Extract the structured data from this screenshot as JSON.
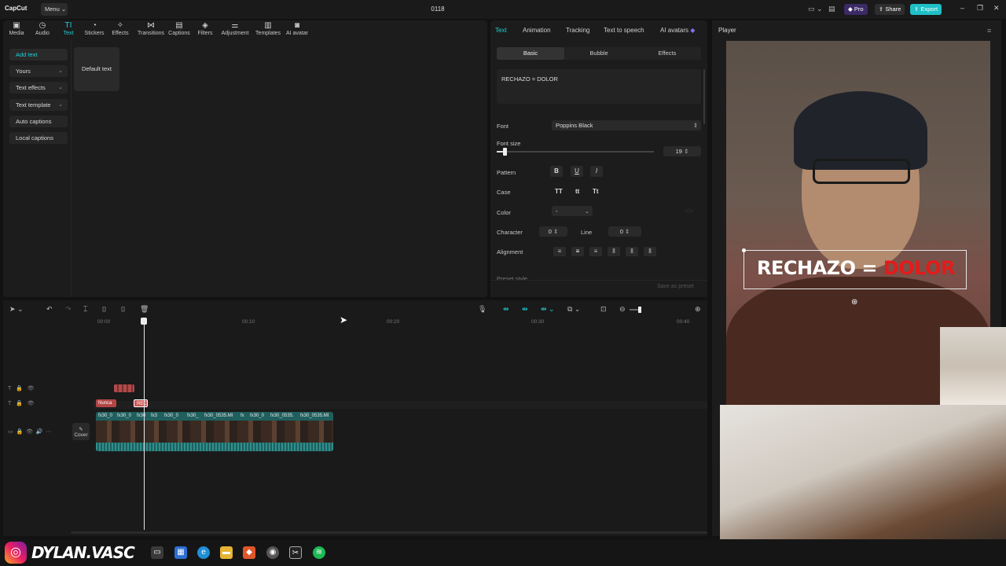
{
  "app": {
    "logo": "CapCut",
    "menu": "Menu",
    "title": "0118",
    "pro": "Pro",
    "share": "Share",
    "export": "Export"
  },
  "toolbar": {
    "items": [
      {
        "label": "Media",
        "icon": "▣"
      },
      {
        "label": "Audio",
        "icon": "◷"
      },
      {
        "label": "Text",
        "icon": "TI"
      },
      {
        "label": "Stickers",
        "icon": "◔"
      },
      {
        "label": "Effects",
        "icon": "✧"
      },
      {
        "label": "Transitions",
        "icon": "⋈"
      },
      {
        "label": "Captions",
        "icon": "▤"
      },
      {
        "label": "Filters",
        "icon": "◈"
      },
      {
        "label": "Adjustment",
        "icon": "⚌"
      },
      {
        "label": "Templates",
        "icon": "▥"
      },
      {
        "label": "AI avatar",
        "icon": "◙"
      }
    ]
  },
  "sidebar": {
    "items": [
      {
        "label": "Add text",
        "chev": ""
      },
      {
        "label": "Yours",
        "chev": "⌄"
      },
      {
        "label": "Text effects",
        "chev": "⌄"
      },
      {
        "label": "Text template",
        "chev": "⌄"
      },
      {
        "label": "Auto captions",
        "chev": ""
      },
      {
        "label": "Local captions",
        "chev": ""
      }
    ],
    "default_text": "Default text"
  },
  "inspector": {
    "tabs": [
      "Text",
      "Animation",
      "Tracking",
      "Text to speech",
      "AI avatars"
    ],
    "subtabs": [
      "Basic",
      "Bubble",
      "Effects"
    ],
    "text_value": "RECHAZO = DOLOR",
    "font_label": "Font",
    "font_value": "Poppins Black",
    "font_size_label": "Font size",
    "font_size_value": "19",
    "pattern_label": "Pattern",
    "pattern_b": "B",
    "pattern_u": "U",
    "pattern_i": "I",
    "case_label": "Case",
    "case_tt": "TT",
    "case_lower": "tt",
    "case_title": "Tt",
    "color_label": "Color",
    "color_value": "-",
    "character_label": "Character",
    "character_value": "0",
    "line_label": "Line",
    "line_value": "0",
    "alignment_label": "Alignment",
    "preset_label": "Preset style",
    "save_preset": "Save as preset"
  },
  "timeline": {
    "ruler": [
      "00:00",
      "00:10",
      "00:20",
      "00:30",
      "00:40"
    ],
    "clip_nunca": "Nunca",
    "clip_rec": "REC",
    "cover": "Cover",
    "video_clips": [
      "fx30_0",
      "fx30_0",
      "fx30",
      "fx3",
      "fx30_0",
      "fx30_",
      "fx30_0535.MI",
      "fx",
      "fx30_0",
      "fx30_0535.",
      "fx30_0535.MI"
    ]
  },
  "player": {
    "title": "Player",
    "overlay_white": "RECHAZO = ",
    "overlay_red": "DOLOR"
  },
  "taskbar": {
    "username": "DYLAN.VASC"
  },
  "colors": {
    "accent": "#1ed2d8",
    "red": "#e31b1b",
    "pro": "#6b3fd4",
    "export": "#1ed2d8"
  }
}
